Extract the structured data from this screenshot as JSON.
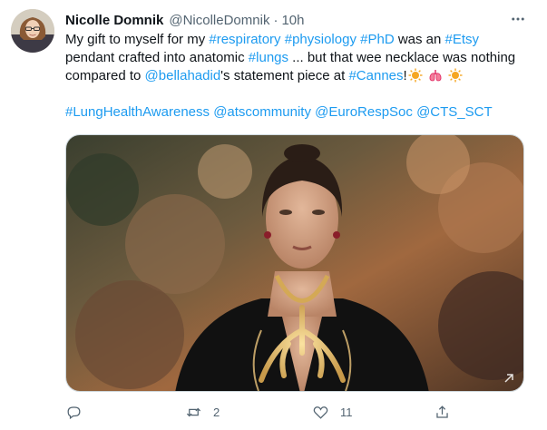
{
  "tweet": {
    "author_name": "Nicolle Domnik",
    "author_handle": "@NicolleDomnik",
    "separator": "·",
    "timestamp": "10h",
    "text_lines": [
      [
        {
          "t": "My gift to myself for my ",
          "link": false
        },
        {
          "t": "#respiratory",
          "link": true
        },
        {
          "t": " ",
          "link": false
        },
        {
          "t": "#physiology",
          "link": true
        },
        {
          "t": " ",
          "link": false
        },
        {
          "t": "#PhD",
          "link": true
        },
        {
          "t": " was an ",
          "link": false
        },
        {
          "t": "#Etsy",
          "link": true
        }
      ],
      [
        {
          "t": "pendant crafted into anatomic ",
          "link": false
        },
        {
          "t": "#lungs",
          "link": true
        },
        {
          "t": " ... but that wee necklace was nothing",
          "link": false
        }
      ],
      [
        {
          "t": "compared to ",
          "link": false
        },
        {
          "t": "@bellahadid",
          "link": true
        },
        {
          "t": "'s statement piece at ",
          "link": false
        },
        {
          "t": "#Cannes",
          "link": true
        },
        {
          "t": "!",
          "link": false
        },
        {
          "emoji": "sun"
        },
        {
          "t": " ",
          "link": false
        },
        {
          "emoji": "lungs"
        },
        {
          "t": " ",
          "link": false
        },
        {
          "emoji": "sun"
        }
      ],
      [],
      [
        {
          "t": "#LungHealthAwareness",
          "link": true
        },
        {
          "t": "  ",
          "link": false
        },
        {
          "t": "@atscommunity",
          "link": true
        },
        {
          "t": " ",
          "link": false
        },
        {
          "t": "@EuroRespSoc",
          "link": true
        },
        {
          "t": " ",
          "link": false
        },
        {
          "t": "@CTS_SCT",
          "link": true
        }
      ]
    ]
  },
  "actions": {
    "reply_count": "",
    "retweet_count": "2",
    "like_count": "11"
  },
  "colors": {
    "link": "#1d9bf0",
    "muted": "#536471",
    "text": "#0f1419"
  },
  "icons": {
    "more": "ellipsis-icon",
    "reply": "reply-icon",
    "retweet": "retweet-icon",
    "like": "heart-icon",
    "share": "share-icon"
  }
}
